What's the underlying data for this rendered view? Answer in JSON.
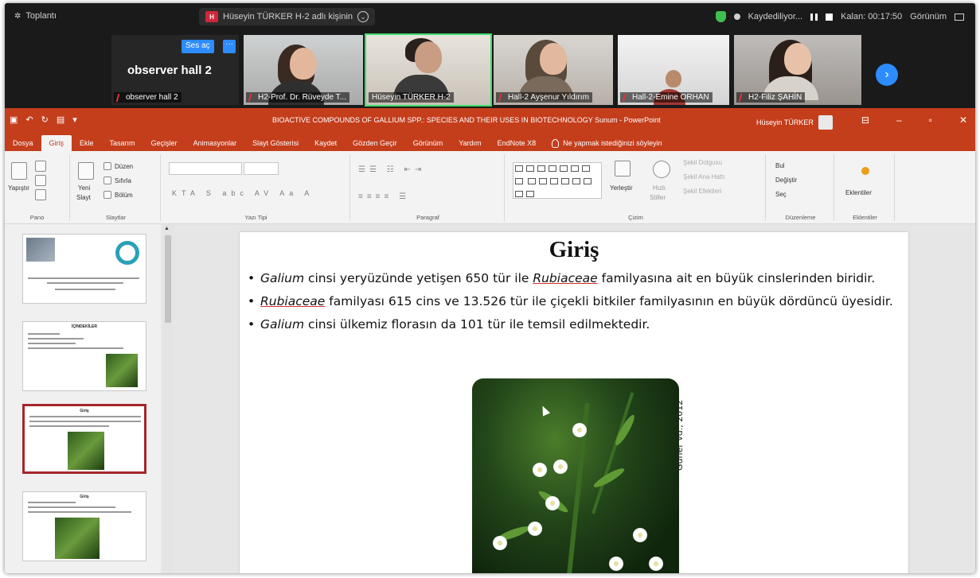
{
  "zoom": {
    "meeting_label": "Toplantı",
    "share_status": "Hüseyin TÜRKER H-2 adlı kişinin",
    "share_badge": "H",
    "recording": "Kaydediliyor...",
    "time": "Kalan: 00:17:50",
    "view": "Görünüm"
  },
  "participants": {
    "observer": {
      "title": "observer hall 2",
      "name": "observer hall 2",
      "unmute": "Ses aç",
      "more": "···"
    },
    "tiles": [
      {
        "name": "H2-Prof. Dr. Rüveyde T..."
      },
      {
        "name": "Hüseyin TÜRKER H-2"
      },
      {
        "name": "Hall-2 Ayşenur Yıldırım"
      },
      {
        "name": "Hall-2-Emine ORHAN"
      },
      {
        "name": "H2-Filiz ŞAHİN"
      }
    ]
  },
  "powerpoint": {
    "title": "BIOACTIVE COMPOUNDS OF GALLIUM SPP.: SPECIES AND THEIR USES IN BIOTECHNOLOGY  Sunum  -  PowerPoint",
    "user": "Hüseyin TÜRKER",
    "tabs": [
      "Dosya",
      "Giriş",
      "Ekle",
      "Tasarım",
      "Geçişler",
      "Animasyonlar",
      "Slayt Gösterisi",
      "Kaydet",
      "Gözden Geçir",
      "Görünüm",
      "Yardım",
      "EndNote X8"
    ],
    "help_search": "Ne yapmak istediğinizi söyleyin",
    "ribbon": {
      "pano": "Pano",
      "paste": "Yapıştır",
      "new_slide_1": "Yeni",
      "new_slide_2": "Slayt",
      "layout": "Düzen",
      "reset": "Sıfırla",
      "section": "Bölüm",
      "slides": "Slaytlar",
      "font": "Yazı Tipi",
      "paragraph": "Paragraf",
      "arrange": "Yerleştir",
      "quick_styles_1": "Hızlı",
      "quick_styles_2": "Stiller",
      "shape_fill": "Şekil Dolgusu",
      "shape_outline": "Şekil Ana Hattı",
      "shape_effects": "Şekil Efektleri",
      "drawing": "Çizim",
      "find": "Bul",
      "replace": "Değiştir",
      "select": "Seç",
      "editing": "Düzenleme",
      "addins_btn": "Eklentiler",
      "addins": "Eklentiler"
    }
  },
  "thumbnails": [
    {
      "title": ""
    },
    {
      "title": "İÇİNDEKİLER"
    },
    {
      "title": "Giriş"
    },
    {
      "title": "Giriş"
    }
  ],
  "slide": {
    "title": "Giriş",
    "bullets": [
      {
        "a": "Galium",
        "b": " cinsi yeryüzünde yetişen 650 tür ile ",
        "c": "Rubiaceae",
        "d": " familyasına ait en büyük cinslerinden biridir."
      },
      {
        "a": "Rubiaceae",
        "b": " familyası 615 cins ve 13.526 tür ile çiçekli bitkiler familyasının en büyük dördüncü üyesidir."
      },
      {
        "a": "Galium",
        "b": " cinsi ülkemiz florasın da 101 tür ile temsil edilmektedir."
      }
    ],
    "image_credit": "Güner vd., 2012"
  },
  "colors": {
    "ppt_accent": "#c43e1c",
    "zoom_blue": "#2d8cff",
    "active_speaker": "#3fdc6b"
  }
}
